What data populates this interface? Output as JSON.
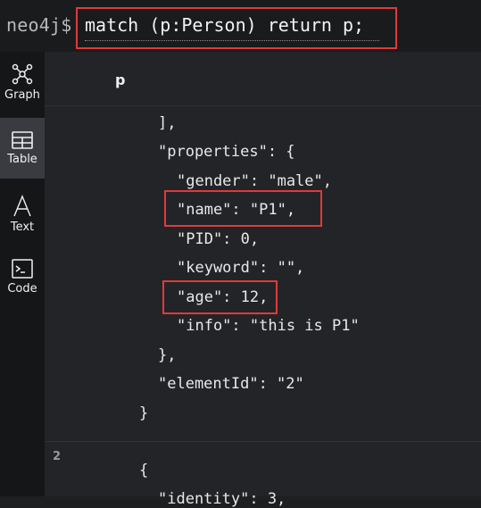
{
  "prompt": "neo4j$",
  "command": "match (p:Person) return p;",
  "sidebar": {
    "items": [
      {
        "label": "Graph",
        "icon": "graph-icon",
        "active": false
      },
      {
        "label": "Table",
        "icon": "table-icon",
        "active": true
      },
      {
        "label": "Text",
        "icon": "text-icon",
        "active": false
      },
      {
        "label": "Code",
        "icon": "code-icon",
        "active": false
      }
    ]
  },
  "table": {
    "column_header": "p",
    "json_lines": [
      "],",
      "\"properties\": {",
      "\"gender\": \"male\",",
      "\"name\": \"P1\",",
      "\"PID\": 0,",
      "\"keyword\": \"\",",
      "\"age\": 12,",
      "\"info\": \"this is P1\"",
      "},",
      "\"elementId\": \"2\"",
      "}"
    ],
    "next_row_number": "2",
    "next_row_lines": [
      "{",
      "\"identity\": 3,"
    ]
  },
  "colors": {
    "highlight": "#e03a3a",
    "background": "#232427",
    "sidebar_active": "#3a3b40"
  }
}
